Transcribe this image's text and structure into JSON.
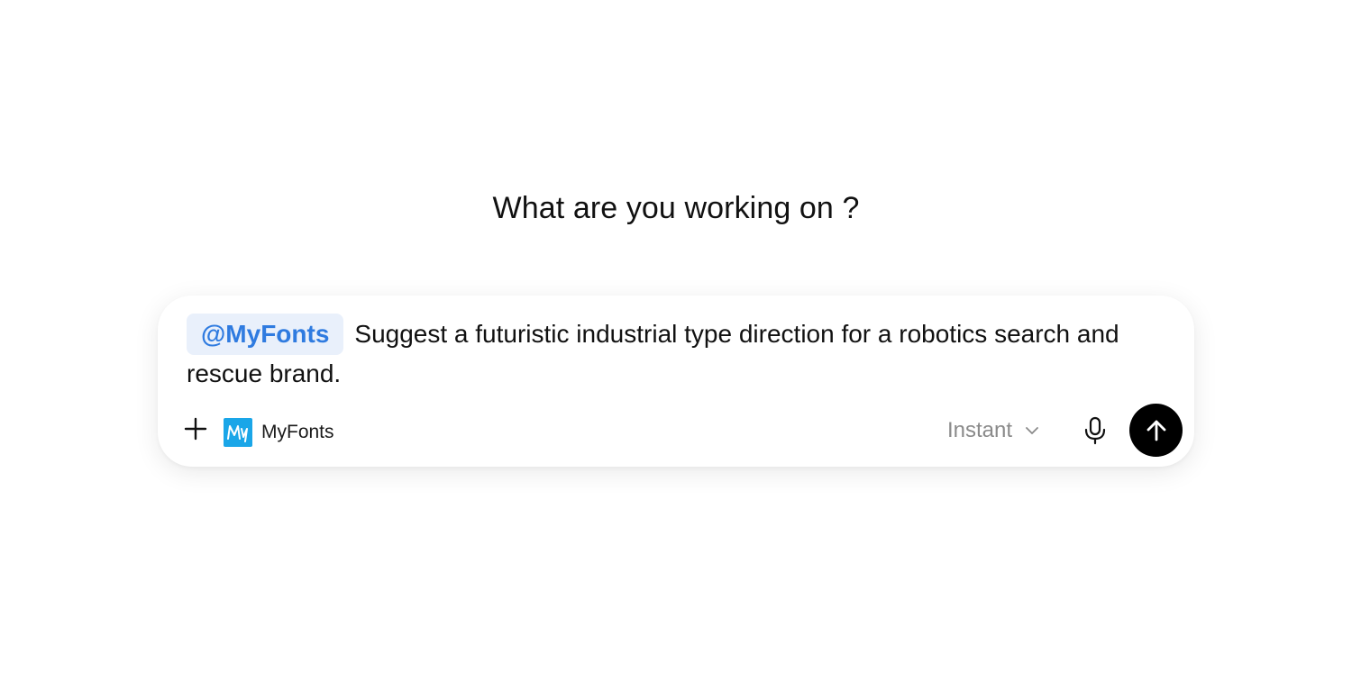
{
  "heading": "What are you working on ?",
  "composer": {
    "mention": "@MyFonts",
    "prompt_text": "Suggest a futuristic industrial type direction for a robotics search and rescue brand."
  },
  "toolbar": {
    "add_icon": "plus-icon",
    "app": {
      "icon": "myfonts-logo",
      "label": "MyFonts",
      "color": "#1aa6e8"
    },
    "mode": {
      "selected": "Instant",
      "icon": "chevron-down-icon"
    },
    "mic_icon": "microphone-icon",
    "send_icon": "arrow-up-icon"
  },
  "colors": {
    "mention_bg": "#e9f0fb",
    "mention_text": "#2f7be0",
    "send_bg": "#000000"
  }
}
